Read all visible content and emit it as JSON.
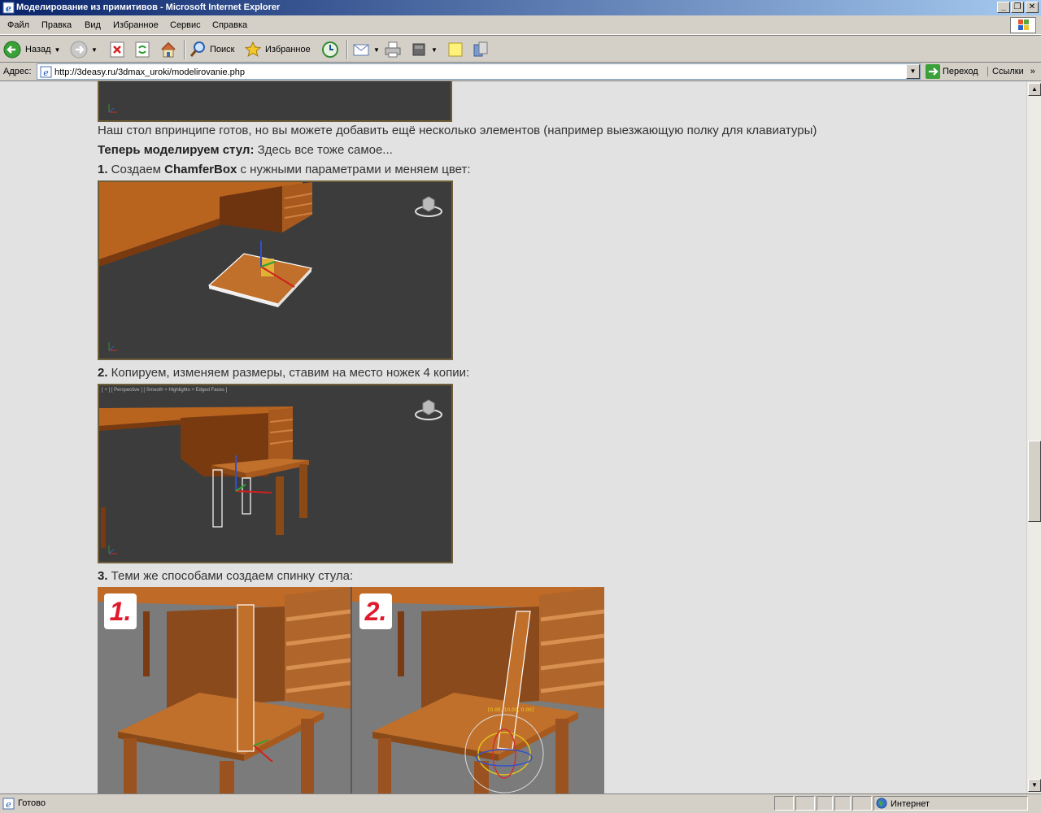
{
  "window": {
    "title": "Моделирование из примитивов - Microsoft Internet Explorer"
  },
  "menu": {
    "items": [
      "Файл",
      "Правка",
      "Вид",
      "Избранное",
      "Сервис",
      "Справка"
    ]
  },
  "toolbar": {
    "back_label": "Назад",
    "search_label": "Поиск",
    "favorites_label": "Избранное"
  },
  "address": {
    "label": "Адрес:",
    "url": "http://3deasy.ru/3dmax_uroki/modelirovanie.php",
    "go_label": "Переход",
    "links_label": "Ссылки"
  },
  "content": {
    "intro_text": "Наш стол впринципе готов, но вы можете добавить ещё несколько элементов (например выезжающую полку для клавиатуры)",
    "chair_heading": "Теперь моделируем стул:",
    "chair_heading_rest": " Здесь все тоже самое...",
    "step1_num": "1.",
    "step1_pre": " Создаем ",
    "step1_bold": "ChamferBox",
    "step1_post": " с нужными параметрами и меняем цвет:",
    "step2_num": "2.",
    "step2_text": " Копируем, изменяем размеры, ставим на место ножек 4 копии:",
    "step3_num": "3.",
    "step3_text": " Теми же способами создаем спинку стула:",
    "viewport_label": "[ + ] [ Perspective ] [ Smooth + Highlights + Edged Faces ]",
    "panel1_badge": "1.",
    "panel2_badge": "2.",
    "gizmo_readout": "[0.00, 10.00, 0.00]"
  },
  "status": {
    "text": "Готово",
    "zone": "Интернет"
  },
  "icons": [
    "ie-page-icon",
    "back-arrow-icon",
    "forward-arrow-icon",
    "stop-icon",
    "refresh-icon",
    "home-icon",
    "search-icon",
    "favorites-star-icon",
    "history-icon",
    "mail-icon",
    "print-icon",
    "edit-icon",
    "discuss-icon",
    "research-icon",
    "go-arrow-icon",
    "globe-icon"
  ],
  "colors": {
    "title_bar": "#0a246a",
    "page_background": "#e2e2e2",
    "wood": "#b8641f",
    "viewport": "#3c3c3c"
  }
}
